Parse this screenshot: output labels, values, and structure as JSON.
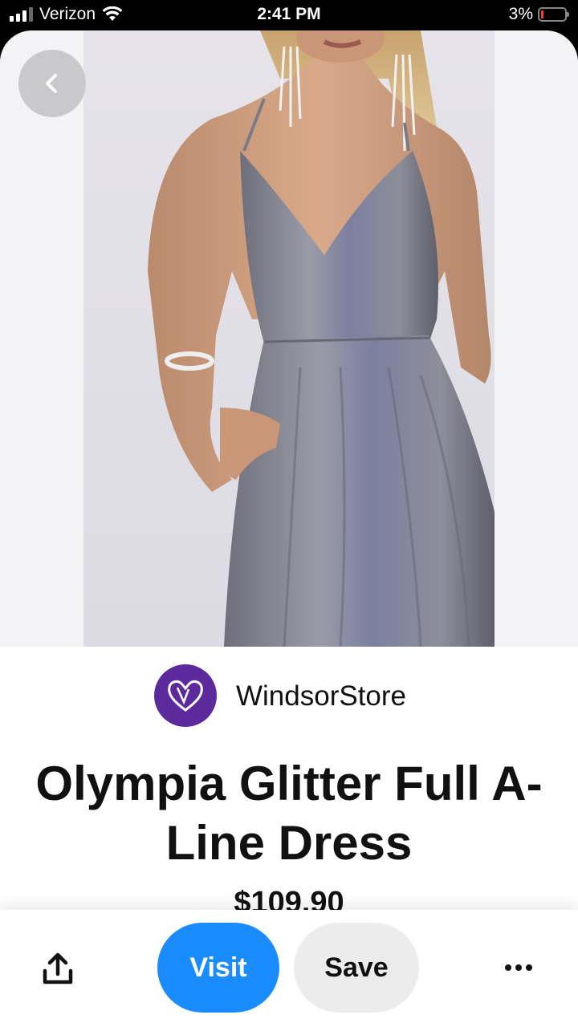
{
  "status_bar": {
    "carrier": "Verizon",
    "time": "2:41 PM",
    "battery_percent": "3%",
    "battery_level": 0.03,
    "battery_color": "#ff3b30"
  },
  "pin": {
    "image_icon": "dress-photo",
    "back_icon": "chevron-left-icon",
    "store": {
      "name": "WindsorStore",
      "logo_color": "#5c2a9d"
    },
    "title": "Olympia Glitter Full A-Line Dress",
    "price": "$109.90"
  },
  "actions": {
    "share_icon": "share-icon",
    "visit_label": "Visit",
    "save_label": "Save",
    "more_icon": "more-icon",
    "visit_color": "#1a8cff"
  }
}
